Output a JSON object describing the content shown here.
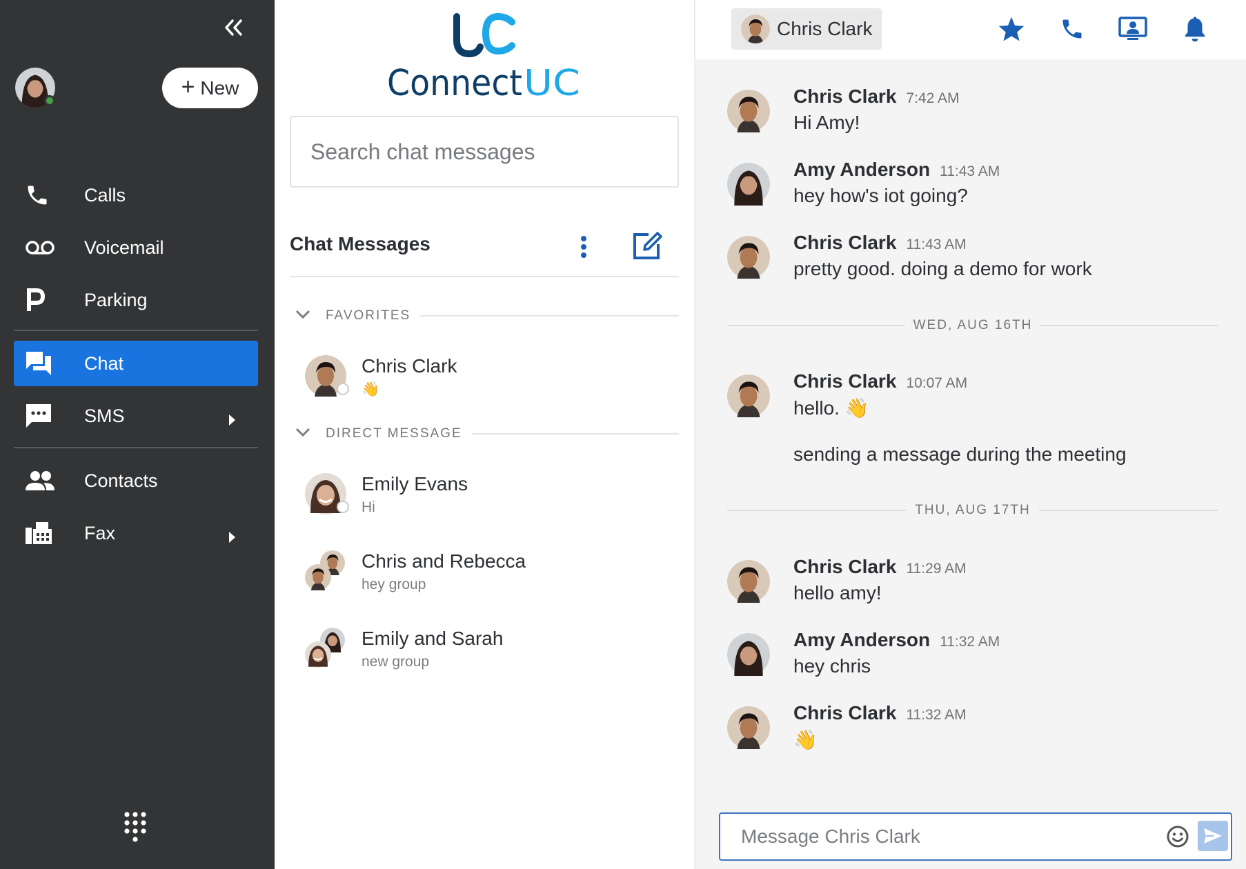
{
  "sidebar": {
    "new_label": "New",
    "nav": [
      {
        "label": "Calls",
        "icon": "phone-icon"
      },
      {
        "label": "Voicemail",
        "icon": "voicemail-icon"
      },
      {
        "label": "Parking",
        "icon": "parking-icon"
      },
      {
        "label": "Chat",
        "icon": "chat-icon",
        "active": true
      },
      {
        "label": "SMS",
        "icon": "sms-icon"
      },
      {
        "label": "Contacts",
        "icon": "contacts-icon"
      },
      {
        "label": "Fax",
        "icon": "fax-icon"
      }
    ]
  },
  "middle": {
    "search_placeholder": "Search chat messages",
    "list_title": "Chat Messages",
    "sections": {
      "favorites": "FAVORITES",
      "direct": "DIRECT MESSAGE"
    },
    "conversations": [
      {
        "name": "Chris Clark",
        "preview": "👋"
      },
      {
        "name": "Emily Evans",
        "preview": "Hi"
      },
      {
        "name": "Chris and Rebecca",
        "preview": "hey group"
      },
      {
        "name": "Emily and Sarah",
        "preview": "new group"
      }
    ]
  },
  "chat": {
    "contact_name": "Chris Clark",
    "dates": [
      "WED, AUG 16TH",
      "THU, AUG 17TH"
    ],
    "messages": [
      {
        "sender": "Chris Clark",
        "time": "7:42 AM",
        "text": "Hi Amy!"
      },
      {
        "sender": "Amy Anderson",
        "time": "11:43 AM",
        "text": "hey how's iot going?"
      },
      {
        "sender": "Chris Clark",
        "time": "11:43 AM",
        "text": "pretty good.  doing a demo for work"
      },
      {
        "sender": "Chris Clark",
        "time": "10:07 AM",
        "text": "hello. 👋",
        "text2": "sending a message during the meeting"
      },
      {
        "sender": "Chris Clark",
        "time": "11:29 AM",
        "text": "hello amy!"
      },
      {
        "sender": "Amy Anderson",
        "time": "11:32 AM",
        "text": "hey chris"
      },
      {
        "sender": "Chris Clark",
        "time": "11:32 AM",
        "text": "👋"
      }
    ],
    "composer_placeholder": "Message Chris Clark"
  },
  "colors": {
    "sidebar_bg": "#333436",
    "accent_blue": "#1a74e0",
    "brand_navy": "#0e3d66",
    "brand_cyan": "#1fa8e8",
    "presence_green": "#43a047"
  }
}
